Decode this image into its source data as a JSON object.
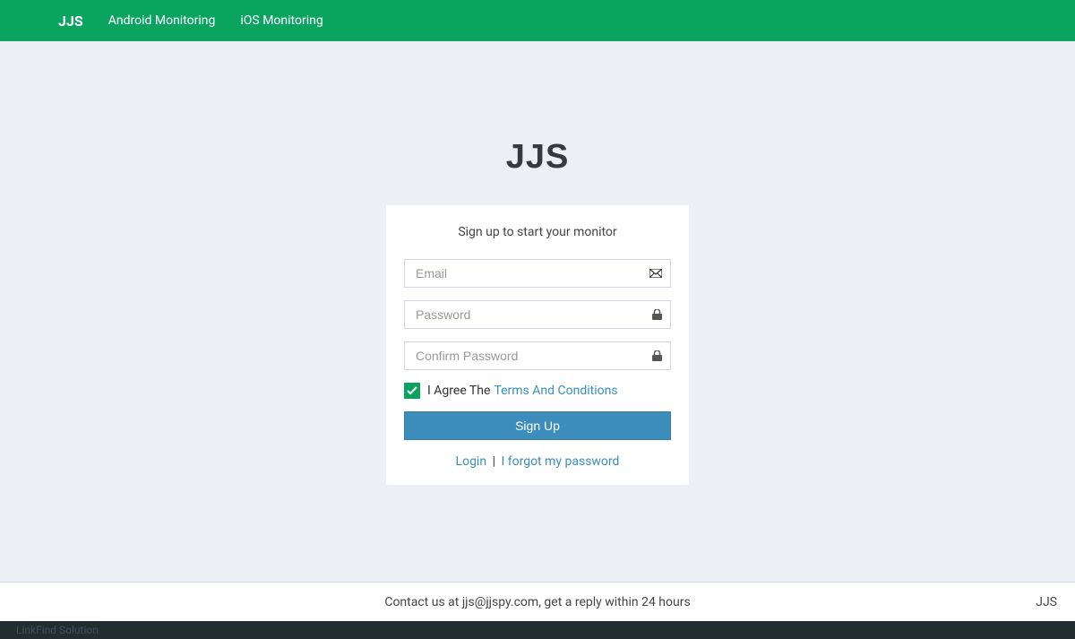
{
  "navbar": {
    "brand": "JJS",
    "links": [
      "Android Monitoring",
      "iOS Monitoring"
    ]
  },
  "page": {
    "logo": "JJS",
    "subtitle": "Sign up to start your monitor"
  },
  "form": {
    "email": {
      "value": "",
      "placeholder": "Email"
    },
    "password": {
      "value": "",
      "placeholder": "Password"
    },
    "confirm": {
      "value": "",
      "placeholder": "Confirm Password"
    },
    "agree_prefix": "I Agree The",
    "terms_link": "Terms And Conditions",
    "submit_label": "Sign Up"
  },
  "links": {
    "login": "Login",
    "separator": "|",
    "forgot": "I forgot my password"
  },
  "footer": {
    "contact": "Contact us at jjs@jjspy.com, get a reply within 24 hours",
    "brand": "JJS"
  },
  "bottombar": {
    "text": "LinkFind Solution"
  }
}
